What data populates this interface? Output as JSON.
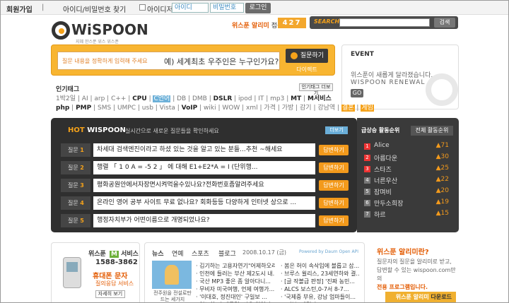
{
  "topbar": {
    "signup": "회원가입",
    "find": "아이디/비밀번호 찾기",
    "save_id": "아이디저장",
    "id_placeholder": "아이디",
    "pw_placeholder": "비밀번호",
    "login": "로그인"
  },
  "header": {
    "logo": "WiSPOON",
    "tagline": "지혜 한스푼 위스 위스푼",
    "alimi": "위스푼 알리미",
    "users_label": "접속자 수",
    "users_count": "427",
    "search_label": "SEARCH",
    "search_btn": "검색"
  },
  "question": {
    "hint": "질문 내용을 정확하게 입력해 주세요",
    "example": "예) 세계최초 우주인은 누구인가요?",
    "ask_btn": "질문하기",
    "direct": "다이렉트"
  },
  "event": {
    "title": "EVENT",
    "line1": "위스푼이 새롭게 달라졌습니다.",
    "line2": "WISPOON RENEWAL",
    "go": "GO"
  },
  "tags": {
    "title": "인기태그",
    "more_btn": "인기태그 더보기",
    "line1": [
      "1박2일",
      "AI",
      "arp",
      "C++",
      "CPU",
      "C언어",
      "DB",
      "DMB",
      "DSLR",
      "ipod",
      "IT",
      "mp3",
      "MT",
      "M서비스"
    ],
    "line2": [
      "php",
      "PMP",
      "SMS",
      "UMPC",
      "usb",
      "Vista",
      "VoIP",
      "wiki",
      "WOW",
      "xml",
      "가격",
      "가방",
      "감기",
      "강남역",
      "결혼",
      "게임"
    ]
  },
  "hot": {
    "title_hot": "HOT",
    "title_brand": "WISPOON",
    "subtitle": "실시간으로 새로운 질문들을 확인하세요",
    "more": "더보기",
    "answer_btn": "답변하기",
    "label": "질문",
    "rows": [
      {
        "n": "1",
        "text": "차세대 검색엔진이라고 하셨 있는 것을 알고 있는 분들...추천 ~해세요"
      },
      {
        "n": "2",
        "text": "행렬 「 1 0 A = -5 2 」 에 대해 E1+E2*A = I (단위행..."
      },
      {
        "n": "3",
        "text": "평화공원안에서자장면시켜먹을수있나요?전화번호좀알려주세요"
      },
      {
        "n": "4",
        "text": "온라인 영어 공부 사이트 무료 없나요? 회화등등 다양하게 인터넷 상으로 ..."
      },
      {
        "n": "5",
        "text": "행정자치부가 어떤이름으로 개명되었나요?"
      }
    ]
  },
  "rank": {
    "tab1": "급상승 활동순위",
    "tab2": "전체 활동순위",
    "items": [
      {
        "n": "1",
        "name": "Alice",
        "chg": "▲71"
      },
      {
        "n": "2",
        "name": "아름다운",
        "chg": "▲30"
      },
      {
        "n": "3",
        "name": "스타즈",
        "chg": "▲25"
      },
      {
        "n": "4",
        "name": "너른우산",
        "chg": "▲22"
      },
      {
        "n": "5",
        "name": "잠며비",
        "chg": "▲20"
      },
      {
        "n": "6",
        "name": "만두소희장",
        "chg": "▲19"
      },
      {
        "n": "7",
        "name": "하르",
        "chg": "▲15"
      }
    ]
  },
  "ad": {
    "brand": "위스푼",
    "m": "M",
    "service": "서비스",
    "phone": "1588-3862",
    "t1": "휴대폰 문자",
    "t2": "질의응답 서비스",
    "more": "자세히 보기"
  },
  "news": {
    "tabs": [
      "뉴스",
      "연예",
      "스포츠",
      "블로그"
    ],
    "date": "2008.10.17 (금)",
    "powered": "Powered by Daum Open API",
    "caption": "전주원을 전설로만 드는 세가지",
    "col1": [
      "김기하는 고용자연기\"어제하오리까'...",
      "인천에 들러는 부산 제2도시 내...",
      "국산 MP3 좋은 좀 알아다니...",
      "무비자 미국여행, 언제 여행가...",
      "'이대호, 정진대인' 구일보 ...",
      "역노한 더 대툴렁, 이유 있었다..."
    ],
    "col2": [
      "봄은 허이 속삭임에 블롭고 삽...",
      "브루스 윌리스, 23세연하와 결...",
      "[글 작볼급 판정] '진짜 농민...",
      "ALCS 보스턴,0-7서 8-7...",
      "'국제중 부유, 강남 엄마들이...",
      "[리뷰] 네덜라, ..."
    ]
  },
  "alimi": {
    "title": "위스푼 알리미란?",
    "desc1": "질문자의 질문을 알리미로 받고,",
    "desc2": "답변할 수 있는 wispoon.com만의",
    "desc3": "전용 프로그램입니다.",
    "download_brand": "위스푼 알리미",
    "download": "다운로드"
  }
}
